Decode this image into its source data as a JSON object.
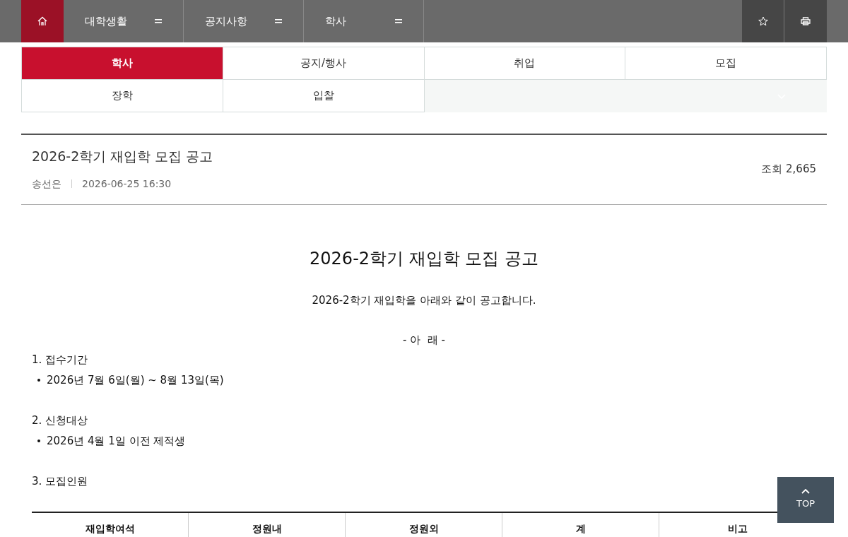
{
  "nav": {
    "menus": [
      {
        "label": "대학생활"
      },
      {
        "label": "공지사항"
      },
      {
        "label": "학사"
      }
    ]
  },
  "category_tabs": [
    {
      "label": "학사",
      "selected": true
    },
    {
      "label": "공지/행사",
      "selected": false
    },
    {
      "label": "취업",
      "selected": false
    },
    {
      "label": "모집",
      "selected": false
    },
    {
      "label": "장학",
      "selected": false
    },
    {
      "label": "입찰",
      "selected": false
    }
  ],
  "article": {
    "title": "2026-2학기 재입학 모집 공고",
    "author": "송선은",
    "date": "2026-06-25 16:30",
    "views": "조회 2,665",
    "heading": "2026-2학기 재입학 모집 공고",
    "intro": "2026-2학기 재입학을 아래와 같이 공고합니다.",
    "note": "- 아  래 -",
    "sections": [
      {
        "title": "1. 접수기간",
        "bullets": [
          "2026년 7월 6일(월) ~ 8월 13일(목)"
        ]
      },
      {
        "title": "2. 신청대상",
        "bullets": [
          "2026년 4월 1일 이전 제적생"
        ]
      },
      {
        "title": "3. 모집인원"
      }
    ],
    "table": {
      "columns": [
        "재입학여석",
        "정원내",
        "정원외",
        "계",
        "비고"
      ]
    }
  },
  "top_button": {
    "label": "TOP"
  }
}
